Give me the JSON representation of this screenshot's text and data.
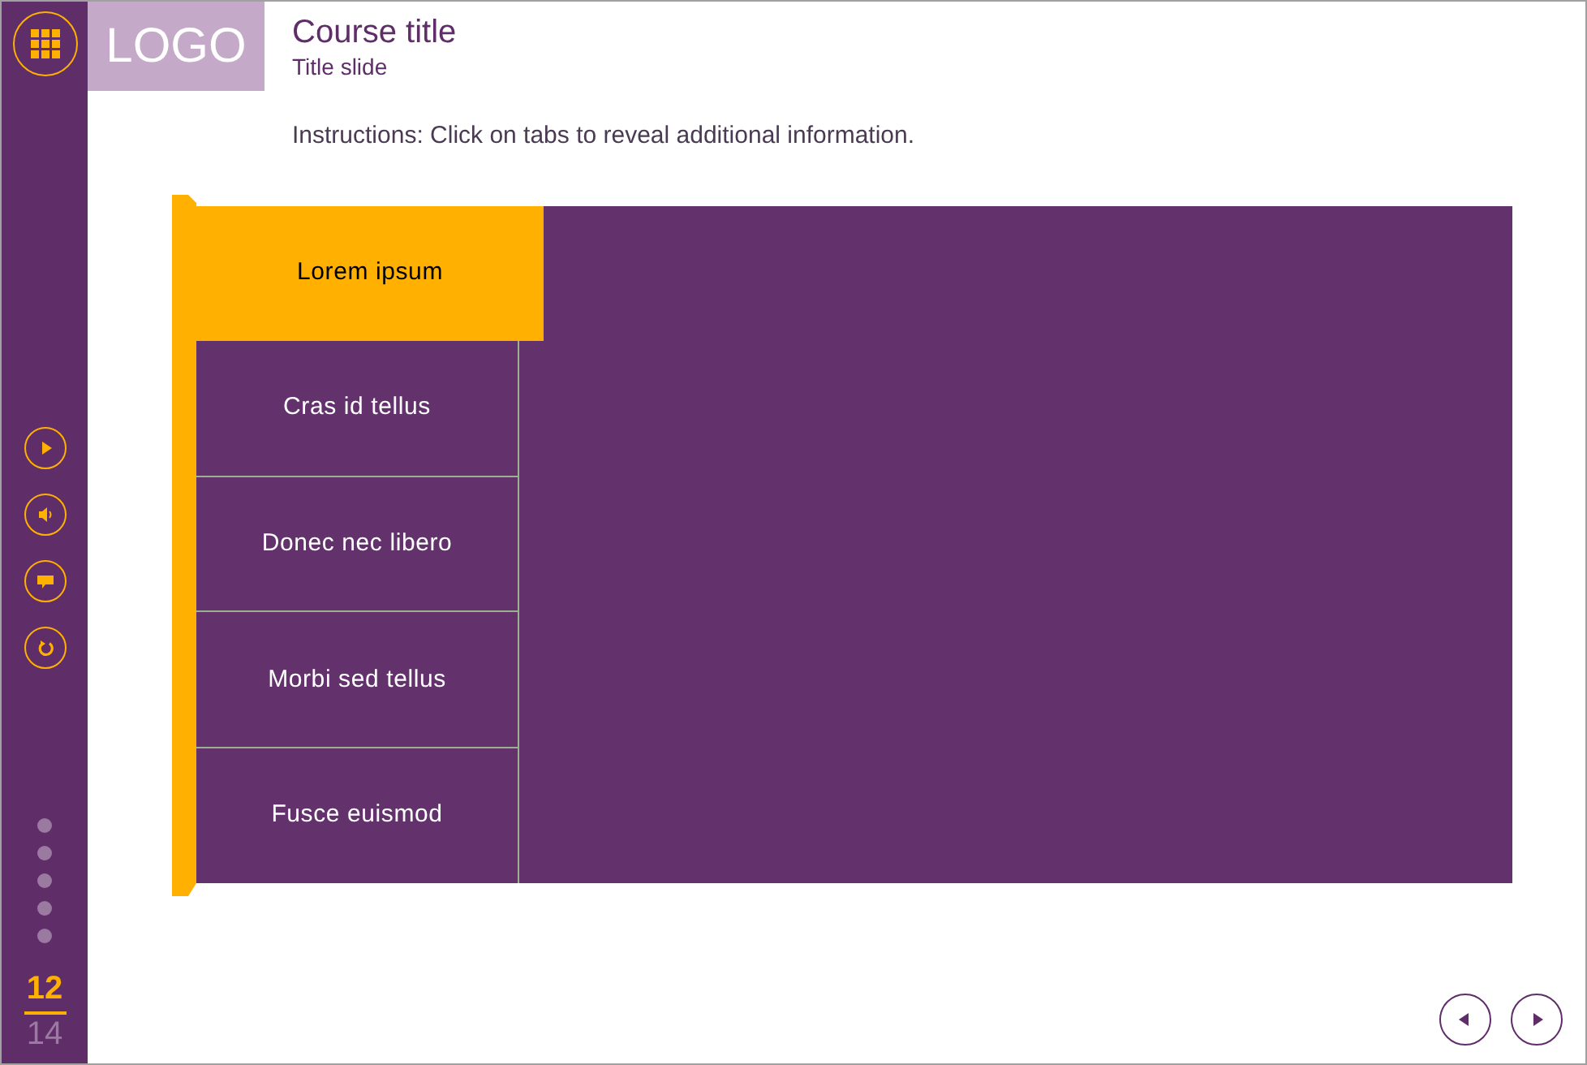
{
  "logo": "LOGO",
  "header": {
    "title": "Course title",
    "subtitle": "Title slide"
  },
  "instructions": "Instructions: Click on tabs to reveal additional information.",
  "tabs": [
    {
      "label": "Lorem ipsum",
      "selected": true
    },
    {
      "label": "Cras id tellus",
      "selected": false
    },
    {
      "label": "Donec nec libero",
      "selected": false
    },
    {
      "label": "Morbi sed tellus",
      "selected": false
    },
    {
      "label": "Fusce euismod",
      "selected": false
    }
  ],
  "sidebar": {
    "tools": [
      {
        "kind": "play"
      },
      {
        "kind": "audio"
      },
      {
        "kind": "comment"
      },
      {
        "kind": "replay"
      }
    ],
    "current_page": "12",
    "total_pages": "14"
  },
  "nav": [
    {
      "kind": "previous"
    },
    {
      "kind": "next"
    }
  ]
}
